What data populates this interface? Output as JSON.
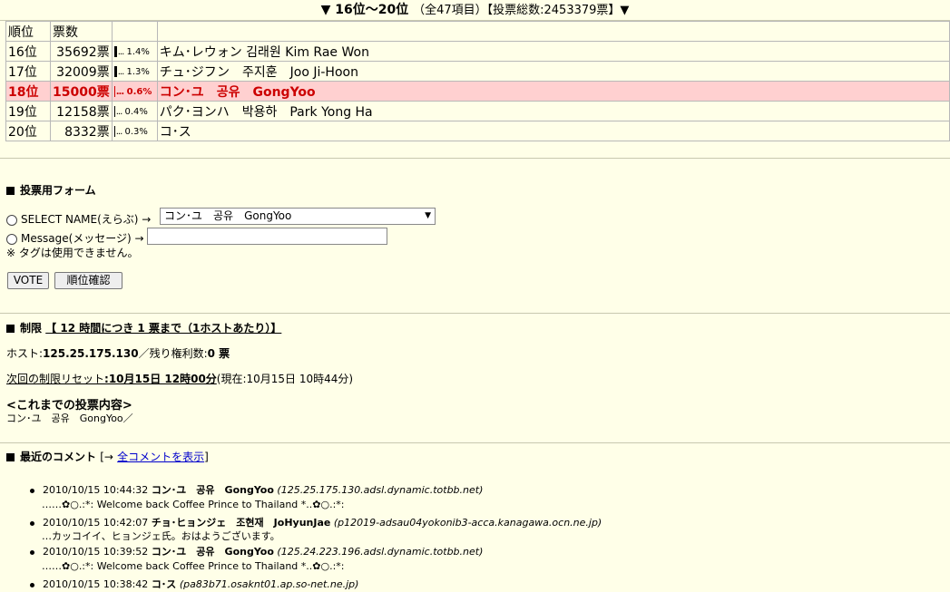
{
  "header": {
    "title": "▼ 16位～20位",
    "subtitle": "（全47項目）【投票総数:2453379票】▼"
  },
  "table": {
    "columns": [
      "順位",
      "票数",
      "",
      ""
    ],
    "rows": [
      {
        "rank": "16位",
        "votes": "35692票",
        "pct": "1.4%",
        "name": "キム･レウォン 김래원 Kim Rae Won",
        "highlight": false
      },
      {
        "rank": "17位",
        "votes": "32009票",
        "pct": "1.3%",
        "name": "チュ･ジフン　주지훈　Joo Ji-Hoon",
        "highlight": false
      },
      {
        "rank": "18位",
        "votes": "15000票",
        "pct": "0.6%",
        "name": "コン･ユ　공유　GongYoo",
        "highlight": true
      },
      {
        "rank": "19位",
        "votes": "12158票",
        "pct": "0.4%",
        "name": "パク･ヨンハ　박용하　Park Yong Ha",
        "highlight": false
      },
      {
        "rank": "20位",
        "votes": "8332票",
        "pct": "0.3%",
        "name": "コ･ス",
        "highlight": false
      }
    ]
  },
  "form": {
    "title": "投票用フォーム",
    "select_label": "SELECT NAME(えらぶ) →",
    "select_value": "コン･ユ　공유　GongYoo",
    "message_label": "Message(メッセージ) →",
    "note": "※ タグは使用できません。",
    "vote_button": "VOTE",
    "rank_button": "順位確認"
  },
  "limit": {
    "title_prefix": "制限",
    "title": "【 12 時間につき 1 票まで（1ホストあたり）】",
    "host_label": "ホスト:",
    "host_value": "125.25.175.130",
    "remaining_label": "／残り権利数:",
    "remaining_value": "0 票",
    "reset_label": "次回の制限リセット",
    "reset_value": ":10月15日 12時00分",
    "reset_now": "(現在:10月15日 10時44分)",
    "history_title": "<これまでの投票内容>",
    "history_value": "コン･ユ　공유　GongYoo／"
  },
  "comments": {
    "title": "最近のコメント",
    "link_prefix": "[→",
    "link": "全コメントを表示",
    "link_suffix": "]",
    "items": [
      {
        "time": "2010/10/15 10:44:32",
        "name": "コン･ユ　공유　GongYoo",
        "host": "(125.25.175.130.adsl.dynamic.totbb.net)",
        "message": "……✿○.:*: Welcome back Coffee Prince to Thailand *..✿○.:*:"
      },
      {
        "time": "2010/10/15 10:42:07",
        "name": "チョ･ヒョンジェ　조현재　JoHyunJae",
        "host": "(p12019-adsau04yokonib3-acca.kanagawa.ocn.ne.jp)",
        "message": "…カッコイイ、ヒョンジェ氏。おはようございます。"
      },
      {
        "time": "2010/10/15 10:39:52",
        "name": "コン･ユ　공유　GongYoo",
        "host": "(125.24.223.196.adsl.dynamic.totbb.net)",
        "message": "……✿○.:*: Welcome back Coffee Prince to Thailand *..✿○.:*:"
      },
      {
        "time": "2010/10/15 10:38:42",
        "name": "コ･ス",
        "host": "(pa83b71.osaknt01.ap.so-net.ne.jp)",
        "message": ""
      }
    ]
  }
}
